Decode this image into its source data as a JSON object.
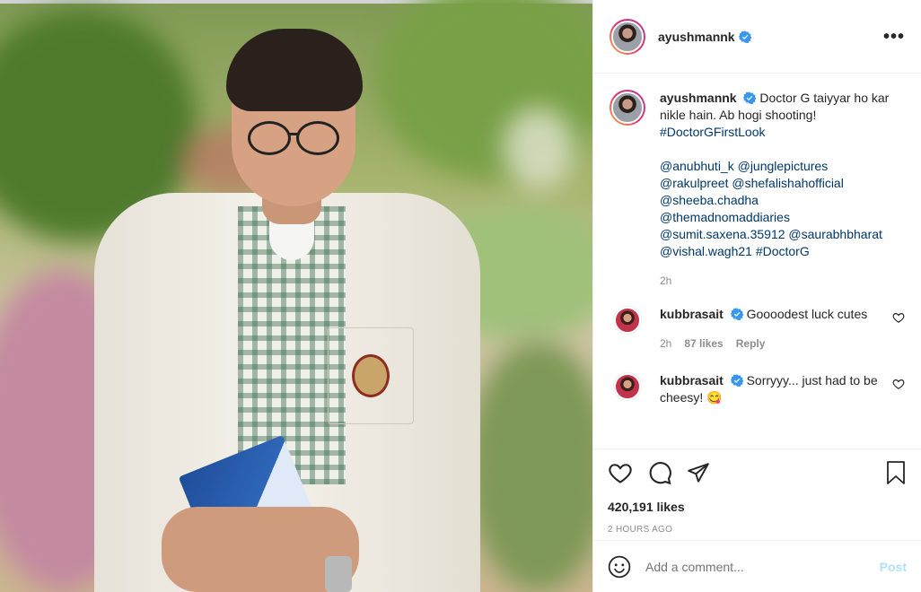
{
  "post": {
    "image_alt": "Doctor G first look",
    "author": "ayushmannk",
    "verified": true,
    "caption_text": "Doctor G taiyyar ho kar nikle hain. Ab hogi shooting!",
    "hashtag_main": "#DoctorGFirstLook",
    "mentions": {
      "m1": "@anubhuti_k",
      "m2": "@junglepictures",
      "m3": "@rakulpreet",
      "m4": "@shefalishahofficial",
      "m5": "@sheeba.chadha",
      "m6": "@themadnomaddiaries",
      "m7": "@sumit.saxena.35912",
      "m8": "@saurabhbharat",
      "m9": "@vishal.wagh21",
      "tag2": "#DoctorG"
    },
    "caption_time": "2h",
    "likes": "420,191 likes",
    "time_ago": "2 HOURS AGO"
  },
  "comments": [
    {
      "user": "kubbrasait",
      "text": "Goooodest luck cutes",
      "time": "2h",
      "likes": "87 likes",
      "reply": "Reply"
    },
    {
      "user": "kubbrasait",
      "text": "Sorryyy... just had to be cheesy! 😋"
    }
  ],
  "compose": {
    "placeholder": "Add a comment...",
    "post_label": "Post"
  },
  "colors": {
    "link": "#00376b",
    "verified": "#3897f0",
    "post_button": "#b2dffc"
  },
  "icons": [
    "more-options-icon",
    "heart-icon",
    "comment-icon",
    "share-icon",
    "bookmark-icon",
    "emoji-icon",
    "verified-badge-icon"
  ]
}
